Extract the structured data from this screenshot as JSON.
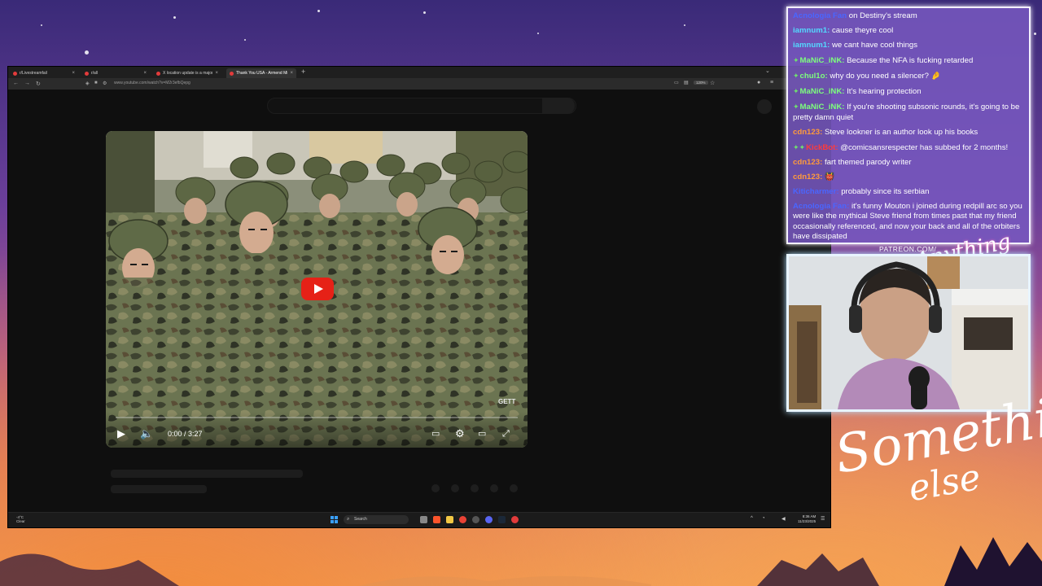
{
  "browser": {
    "tabs": [
      {
        "label": "r/Livestreamfail"
      },
      {
        "label": "r/all"
      },
      {
        "label": "X location update is a major ev"
      },
      {
        "label": "Thank You USA - Armend Mifta"
      }
    ],
    "url": "www.youtube.com/watch?v=M2r3efbQepg",
    "zoom": "120%"
  },
  "player": {
    "time": "0:00 / 3:27",
    "watermark": "GETT"
  },
  "taskbar": {
    "weather_temp": "-4°C",
    "weather_desc": "Clear",
    "search_label": "Search",
    "clock_time": "8:36 AM",
    "clock_date": "11/23/2025"
  },
  "chat": {
    "messages": [
      {
        "user": "Acnologia Fan",
        "user_color": "#4a66ff",
        "text": "on Destiny's stream",
        "badge": ""
      },
      {
        "user": "iamnum1:",
        "user_color": "#53d9ff",
        "text": "cause theyre cool",
        "badge": ""
      },
      {
        "user": "iamnum1:",
        "user_color": "#53d9ff",
        "text": "we cant have cool things",
        "badge": ""
      },
      {
        "user": "MaNiC_iNK:",
        "user_color": "#7dff7d",
        "text": "Because the NFA is fucking retarded",
        "badge": "✦"
      },
      {
        "user": "chul1o:",
        "user_color": "#7dff7d",
        "text": "why do you need a silencer? 🤌",
        "badge": "✦"
      },
      {
        "user": "MaNiC_iNK:",
        "user_color": "#7dff7d",
        "text": "It's hearing protection",
        "badge": "✦"
      },
      {
        "user": "MaNiC_iNK:",
        "user_color": "#7dff7d",
        "text": "If you're shooting subsonic rounds, it's going to be pretty damn quiet",
        "badge": "✦"
      },
      {
        "user": "cdn123:",
        "user_color": "#ff9a3c",
        "text": "Steve lookner is an author look up his books",
        "badge": ""
      },
      {
        "user": "KickBot:",
        "user_color": "#ff3b3b",
        "text": "@comicsansrespecter has subbed for 2 months!",
        "badge": "✦✦"
      },
      {
        "user": "cdn123:",
        "user_color": "#ff9a3c",
        "text": "fart themed parody writer",
        "badge": ""
      },
      {
        "user": "cdn123:",
        "user_color": "#ff9a3c",
        "text": "👹",
        "badge": ""
      },
      {
        "user": "Kiticharmer:",
        "user_color": "#4a66ff",
        "text": "probably since its serbian",
        "badge": ""
      },
      {
        "user": "Acnologia Fan:",
        "user_color": "#4a66ff",
        "text": "it's funny Mouton i joined during redpill arc so you were like the mythical Steve friend from times past that my friend occasionally referenced, and now your back and all of the orbiters have dissipated",
        "badge": ""
      }
    ]
  },
  "overlay": {
    "patreon": "PATREON.COM/",
    "logo_small": "Anything else",
    "signature_line1": "Something",
    "signature_line2": "else"
  },
  "colors": {
    "chat_bg": "#7658be",
    "yt_red": "#e62117"
  }
}
